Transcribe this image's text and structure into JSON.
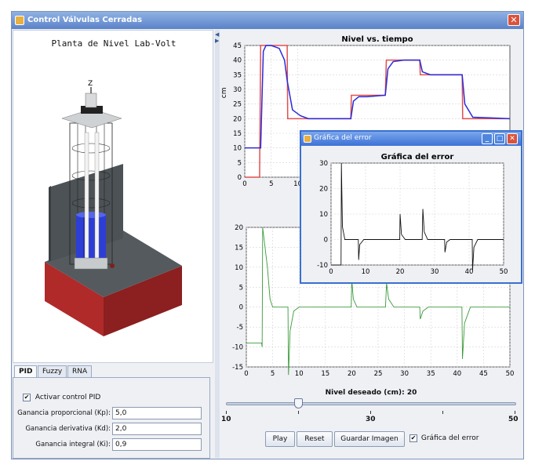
{
  "window": {
    "title": "Control Válvulas Cerradas",
    "close_glyph": "✕",
    "icon": "java-app-icon"
  },
  "left": {
    "title": "Planta de Nivel Lab-Volt",
    "axis_z_label": "Z"
  },
  "tabs": [
    {
      "label": "PID",
      "active": true
    },
    {
      "label": "Fuzzy",
      "active": false
    },
    {
      "label": "RNA",
      "active": false
    }
  ],
  "pid": {
    "activate_label": "Activar control PID",
    "activate_checked": true,
    "kp_label": "Ganancia proporcional (Kp):",
    "kp_value": "5,0",
    "kd_label": "Ganancia derivativa (Kd):",
    "kd_value": "2,0",
    "ki_label": "Ganancia integral (Ki):",
    "ki_value": "0,9"
  },
  "slider": {
    "title": "Nivel deseado (cm): 20",
    "min_label": "10",
    "mid_label": "30",
    "max_label": "50",
    "value": 20,
    "min": 10,
    "max": 50
  },
  "buttons": {
    "play": "Play",
    "reset": "Reset",
    "save": "Guardar Imagen",
    "error_chart_label": "Gráfica del error",
    "error_chart_checked": true
  },
  "popup": {
    "title": "Gráfica del error",
    "minimize_glyph": "_",
    "maximize_glyph": "□",
    "close_glyph": "✕"
  },
  "chart_data": [
    {
      "type": "line",
      "title": "Nivel vs. tiempo",
      "ylabel": "cm",
      "xlim": [
        0,
        50
      ],
      "ylim": [
        0,
        45
      ],
      "x_ticks": [
        0,
        5,
        10
      ],
      "y_ticks": [
        0,
        5,
        10,
        15,
        20,
        25,
        30,
        35,
        40,
        45
      ],
      "grid": true,
      "colors": {
        "setpoint": "#e05050",
        "level": "#2a2ad8"
      },
      "series": [
        {
          "role": "setpoint",
          "x": [
            0,
            2.8,
            3.0,
            3.9,
            4.0,
            8.0,
            8.1,
            20,
            20.1,
            26.5,
            26.7,
            33,
            33.1,
            41,
            41.1,
            50
          ],
          "y": [
            0,
            0,
            45,
            45,
            45,
            45,
            20,
            20,
            28,
            28,
            40,
            40,
            35,
            35,
            20,
            20
          ]
        },
        {
          "role": "level",
          "x": [
            0,
            3.0,
            3.5,
            4.0,
            5.0,
            6.5,
            7.5,
            8.0,
            9.0,
            10.5,
            12,
            20,
            20.5,
            21.5,
            23,
            26.5,
            27,
            28,
            30,
            33,
            33.5,
            35,
            41,
            41.5,
            43,
            50
          ],
          "y": [
            10,
            10,
            43,
            45,
            45,
            44,
            40,
            33,
            23,
            21,
            20,
            20,
            26,
            27.5,
            27.5,
            28,
            37,
            39.5,
            40,
            40,
            36,
            35,
            35,
            25,
            20.5,
            20
          ]
        }
      ]
    },
    {
      "type": "line",
      "title": "",
      "xlim": [
        0,
        50
      ],
      "ylim": [
        -15,
        20
      ],
      "x_ticks": [
        0,
        5,
        10,
        15,
        20,
        25,
        30,
        35,
        40,
        45,
        50
      ],
      "y_ticks": [
        -15,
        -10,
        -5,
        0,
        5,
        10,
        15,
        20
      ],
      "grid": true,
      "colors": {
        "line": "#3a9a3a"
      },
      "series": [
        {
          "role": "control",
          "x": [
            0,
            2.9,
            3.0,
            3.1,
            4.0,
            4.5,
            5.0,
            7.9,
            8.0,
            8.3,
            9.0,
            10,
            19.9,
            20,
            20.3,
            21,
            26.4,
            26.6,
            27.0,
            28,
            32.9,
            33.0,
            33.5,
            34.5,
            40.9,
            41.0,
            41.4,
            42.5,
            50
          ],
          "y": [
            -9,
            -9,
            -10,
            20,
            10,
            2,
            0,
            0,
            -17,
            -6,
            -1,
            0,
            0,
            7,
            2,
            0,
            0,
            6,
            2,
            0,
            0,
            -3,
            -1,
            0,
            0,
            -13,
            -4,
            0,
            0
          ]
        }
      ]
    },
    {
      "type": "line",
      "title": "Gráfica del error",
      "xlim": [
        0,
        50
      ],
      "ylim": [
        -10,
        30
      ],
      "x_ticks": [
        0,
        10,
        20,
        30,
        40,
        50
      ],
      "y_ticks": [
        -10,
        0,
        10,
        20,
        30
      ],
      "grid": true,
      "colors": {
        "line": "#111111"
      },
      "series": [
        {
          "role": "error",
          "x": [
            0,
            2.9,
            3.0,
            3.3,
            4.0,
            5.0,
            7.9,
            8.0,
            8.3,
            9.5,
            19.9,
            20.0,
            20.4,
            21.5,
            26.4,
            26.6,
            27.0,
            28,
            32.9,
            33.0,
            33.5,
            34.5,
            40.9,
            41.0,
            41.4,
            42.5,
            50
          ],
          "y": [
            -10,
            -10,
            30,
            5,
            0,
            0,
            0,
            -8,
            -2,
            0,
            0,
            10,
            2,
            0,
            0,
            12,
            3,
            0,
            0,
            -5,
            -1,
            0,
            0,
            -12,
            -3,
            0,
            0
          ]
        }
      ]
    }
  ]
}
